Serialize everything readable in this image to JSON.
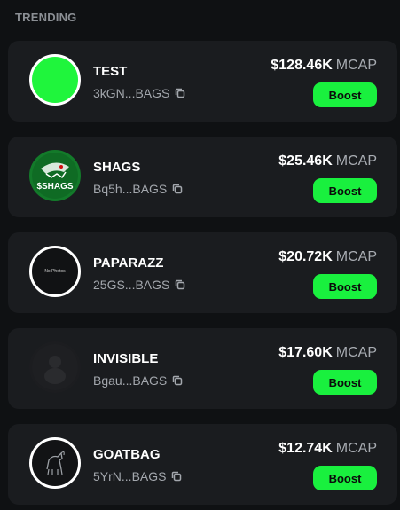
{
  "section": {
    "title": "TRENDING"
  },
  "tokens": [
    {
      "name": "TEST",
      "address": "3kGN...BAGS",
      "mcap": "$128.46K",
      "mcap_unit": "MCAP",
      "boost_label": "Boost",
      "avatar": "green-circle"
    },
    {
      "name": "SHAGS",
      "address": "Bq5h...BAGS",
      "mcap": "$25.46K",
      "mcap_unit": "MCAP",
      "boost_label": "Boost",
      "avatar": "shark-logo",
      "avatar_text": "$SHAGS"
    },
    {
      "name": "PAPARAZZ",
      "address": "25GS...BAGS",
      "mcap": "$20.72K",
      "mcap_unit": "MCAP",
      "boost_label": "Boost",
      "avatar": "no-photo",
      "avatar_text": "No Photos"
    },
    {
      "name": "INVISIBLE",
      "address": "Bgau...BAGS",
      "mcap": "$17.60K",
      "mcap_unit": "MCAP",
      "boost_label": "Boost",
      "avatar": "shadow-figure"
    },
    {
      "name": "GOATBAG",
      "address": "5YrN...BAGS",
      "mcap": "$12.74K",
      "mcap_unit": "MCAP",
      "boost_label": "Boost",
      "avatar": "goat-sketch"
    }
  ],
  "colors": {
    "accent": "#19f03e",
    "card": "#1a1c1f",
    "background": "#0f1113"
  }
}
